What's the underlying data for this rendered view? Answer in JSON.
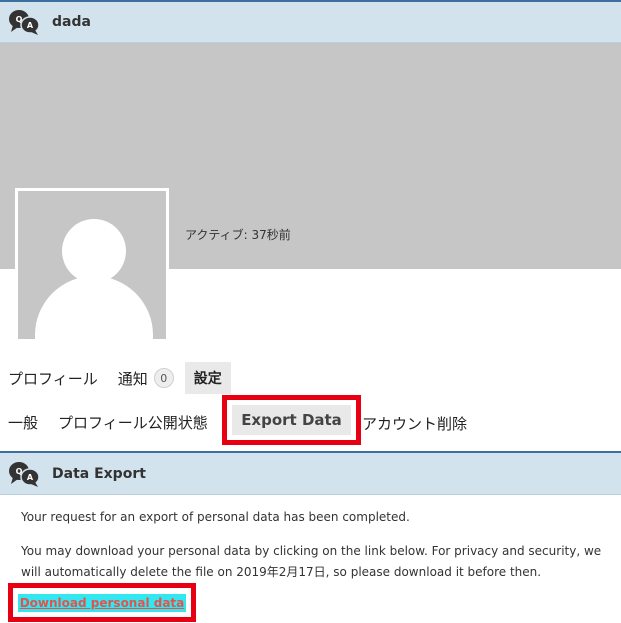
{
  "header": {
    "title": "dada",
    "icon": "qa-bubbles-icon"
  },
  "profile": {
    "active_status": "アクティブ: 37秒前"
  },
  "main_nav": {
    "profile": "プロフィール",
    "notifications": "通知",
    "notification_count": "0",
    "settings": "設定"
  },
  "sub_nav": {
    "general": "一般",
    "visibility": "プロフィール公開状態",
    "export": "Export Data",
    "delete": "アカウント削除"
  },
  "section": {
    "title": "Data Export"
  },
  "messages": {
    "completed": "Your request for an export of personal data has been completed.",
    "download_info": "You may download your personal data by clicking on the link below. For privacy and security, we will automatically delete the file on 2019年2月17日, so please download it before then."
  },
  "download": {
    "label": "Download personal data"
  },
  "colors": {
    "header_bg": "#d3e3ee",
    "header_border": "#3c6e9e",
    "highlight_box": "#e60012",
    "link_bg": "#33e7f0",
    "link_text": "#e8504c"
  }
}
